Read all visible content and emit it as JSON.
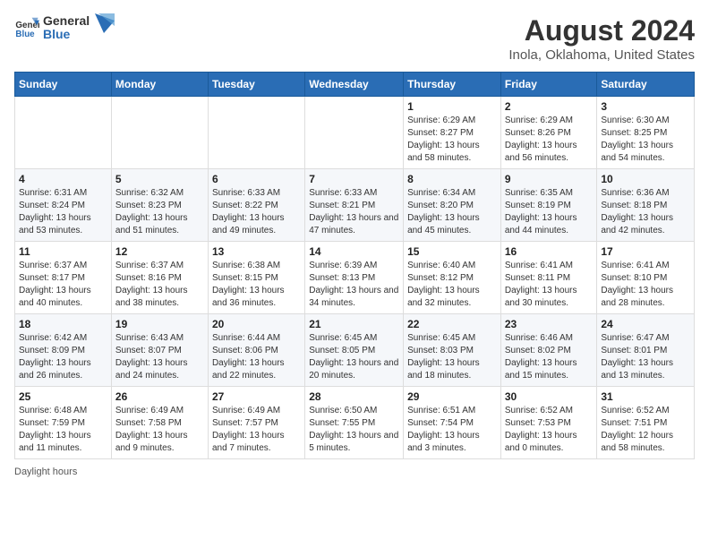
{
  "logo": {
    "line1": "General",
    "line2": "Blue"
  },
  "title": "August 2024",
  "subtitle": "Inola, Oklahoma, United States",
  "days_of_week": [
    "Sunday",
    "Monday",
    "Tuesday",
    "Wednesday",
    "Thursday",
    "Friday",
    "Saturday"
  ],
  "weeks": [
    [
      {
        "day": "",
        "info": ""
      },
      {
        "day": "",
        "info": ""
      },
      {
        "day": "",
        "info": ""
      },
      {
        "day": "",
        "info": ""
      },
      {
        "day": "1",
        "info": "Sunrise: 6:29 AM\nSunset: 8:27 PM\nDaylight: 13 hours and 58 minutes."
      },
      {
        "day": "2",
        "info": "Sunrise: 6:29 AM\nSunset: 8:26 PM\nDaylight: 13 hours and 56 minutes."
      },
      {
        "day": "3",
        "info": "Sunrise: 6:30 AM\nSunset: 8:25 PM\nDaylight: 13 hours and 54 minutes."
      }
    ],
    [
      {
        "day": "4",
        "info": "Sunrise: 6:31 AM\nSunset: 8:24 PM\nDaylight: 13 hours and 53 minutes."
      },
      {
        "day": "5",
        "info": "Sunrise: 6:32 AM\nSunset: 8:23 PM\nDaylight: 13 hours and 51 minutes."
      },
      {
        "day": "6",
        "info": "Sunrise: 6:33 AM\nSunset: 8:22 PM\nDaylight: 13 hours and 49 minutes."
      },
      {
        "day": "7",
        "info": "Sunrise: 6:33 AM\nSunset: 8:21 PM\nDaylight: 13 hours and 47 minutes."
      },
      {
        "day": "8",
        "info": "Sunrise: 6:34 AM\nSunset: 8:20 PM\nDaylight: 13 hours and 45 minutes."
      },
      {
        "day": "9",
        "info": "Sunrise: 6:35 AM\nSunset: 8:19 PM\nDaylight: 13 hours and 44 minutes."
      },
      {
        "day": "10",
        "info": "Sunrise: 6:36 AM\nSunset: 8:18 PM\nDaylight: 13 hours and 42 minutes."
      }
    ],
    [
      {
        "day": "11",
        "info": "Sunrise: 6:37 AM\nSunset: 8:17 PM\nDaylight: 13 hours and 40 minutes."
      },
      {
        "day": "12",
        "info": "Sunrise: 6:37 AM\nSunset: 8:16 PM\nDaylight: 13 hours and 38 minutes."
      },
      {
        "day": "13",
        "info": "Sunrise: 6:38 AM\nSunset: 8:15 PM\nDaylight: 13 hours and 36 minutes."
      },
      {
        "day": "14",
        "info": "Sunrise: 6:39 AM\nSunset: 8:13 PM\nDaylight: 13 hours and 34 minutes."
      },
      {
        "day": "15",
        "info": "Sunrise: 6:40 AM\nSunset: 8:12 PM\nDaylight: 13 hours and 32 minutes."
      },
      {
        "day": "16",
        "info": "Sunrise: 6:41 AM\nSunset: 8:11 PM\nDaylight: 13 hours and 30 minutes."
      },
      {
        "day": "17",
        "info": "Sunrise: 6:41 AM\nSunset: 8:10 PM\nDaylight: 13 hours and 28 minutes."
      }
    ],
    [
      {
        "day": "18",
        "info": "Sunrise: 6:42 AM\nSunset: 8:09 PM\nDaylight: 13 hours and 26 minutes."
      },
      {
        "day": "19",
        "info": "Sunrise: 6:43 AM\nSunset: 8:07 PM\nDaylight: 13 hours and 24 minutes."
      },
      {
        "day": "20",
        "info": "Sunrise: 6:44 AM\nSunset: 8:06 PM\nDaylight: 13 hours and 22 minutes."
      },
      {
        "day": "21",
        "info": "Sunrise: 6:45 AM\nSunset: 8:05 PM\nDaylight: 13 hours and 20 minutes."
      },
      {
        "day": "22",
        "info": "Sunrise: 6:45 AM\nSunset: 8:03 PM\nDaylight: 13 hours and 18 minutes."
      },
      {
        "day": "23",
        "info": "Sunrise: 6:46 AM\nSunset: 8:02 PM\nDaylight: 13 hours and 15 minutes."
      },
      {
        "day": "24",
        "info": "Sunrise: 6:47 AM\nSunset: 8:01 PM\nDaylight: 13 hours and 13 minutes."
      }
    ],
    [
      {
        "day": "25",
        "info": "Sunrise: 6:48 AM\nSunset: 7:59 PM\nDaylight: 13 hours and 11 minutes."
      },
      {
        "day": "26",
        "info": "Sunrise: 6:49 AM\nSunset: 7:58 PM\nDaylight: 13 hours and 9 minutes."
      },
      {
        "day": "27",
        "info": "Sunrise: 6:49 AM\nSunset: 7:57 PM\nDaylight: 13 hours and 7 minutes."
      },
      {
        "day": "28",
        "info": "Sunrise: 6:50 AM\nSunset: 7:55 PM\nDaylight: 13 hours and 5 minutes."
      },
      {
        "day": "29",
        "info": "Sunrise: 6:51 AM\nSunset: 7:54 PM\nDaylight: 13 hours and 3 minutes."
      },
      {
        "day": "30",
        "info": "Sunrise: 6:52 AM\nSunset: 7:53 PM\nDaylight: 13 hours and 0 minutes."
      },
      {
        "day": "31",
        "info": "Sunrise: 6:52 AM\nSunset: 7:51 PM\nDaylight: 12 hours and 58 minutes."
      }
    ]
  ],
  "footer": "Daylight hours"
}
